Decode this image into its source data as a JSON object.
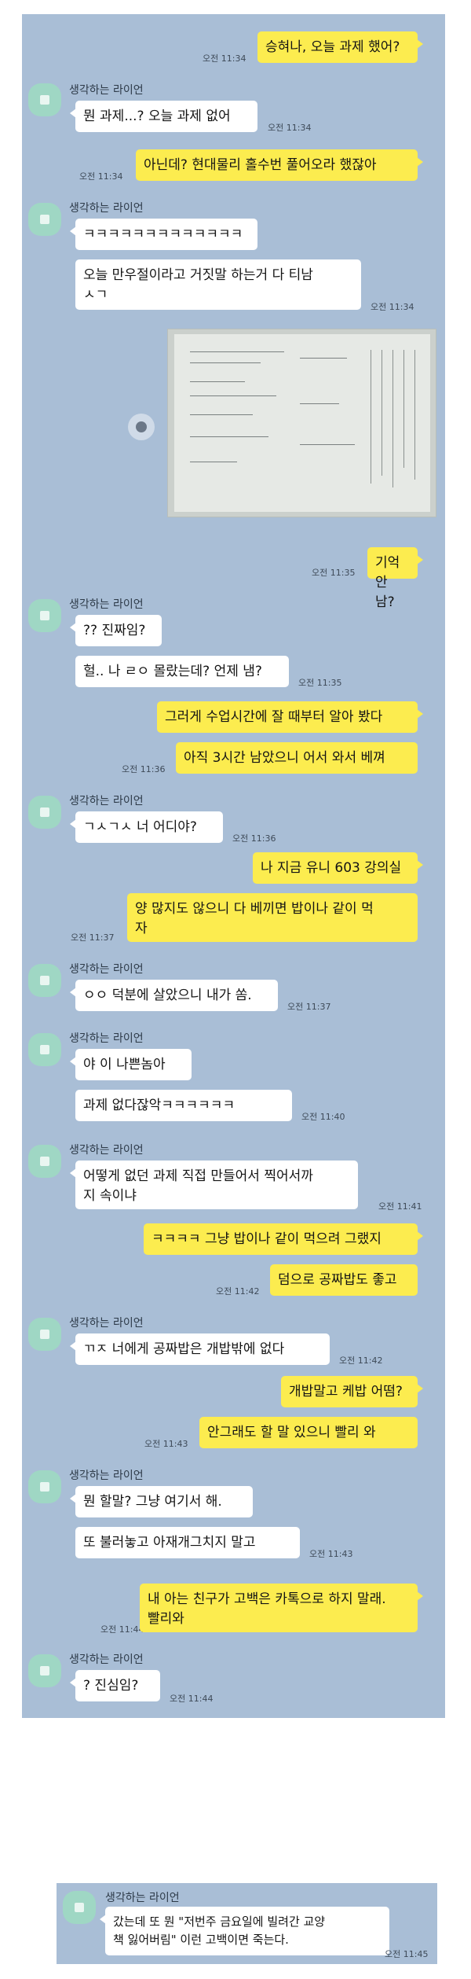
{
  "sender_name": "생각하는 라이언",
  "messages": [
    {
      "id": "m1",
      "side": "out",
      "text": "승혀나, 오늘 과제 했어?",
      "time": "오전 11:34"
    },
    {
      "id": "m2",
      "side": "in",
      "text": "뭔 과제...? 오늘 과제 없어",
      "time": "오전 11:34"
    },
    {
      "id": "m3",
      "side": "out",
      "text": "아닌데? 현대물리 홀수번 풀어오라 했잖아",
      "time": "오전 11:34"
    },
    {
      "id": "m4",
      "side": "in",
      "text": "ㅋㅋㅋㅋㅋㅋㅋㅋㅋㅋㅋㅋㅋ",
      "time": ""
    },
    {
      "id": "m5",
      "side": "in",
      "text": "오늘 만우절이라고 거짓말 하는거 다 티남\nㅅㄱ",
      "time": "오전 11:34"
    },
    {
      "id": "m6",
      "side": "out",
      "text": "기억 안 남?",
      "time": "오전 11:35"
    },
    {
      "id": "m7",
      "side": "in",
      "text": "?? 진짜임?",
      "time": ""
    },
    {
      "id": "m8",
      "side": "in",
      "text": "헐.. 나 ㄹㅇ 몰랐는데? 언제 냄?",
      "time": "오전 11:35"
    },
    {
      "id": "m9",
      "side": "out",
      "text": "그러게 수업시간에 잘 때부터 알아 봤다",
      "time": ""
    },
    {
      "id": "m10",
      "side": "out",
      "text": "아직 3시간 남았으니 어서 와서 베껴",
      "time": "오전 11:36"
    },
    {
      "id": "m11",
      "side": "in",
      "text": "ㄱㅅㄱㅅ 너 어디야?",
      "time": "오전 11:36"
    },
    {
      "id": "m12",
      "side": "out",
      "text": "나 지금 유니 603 강의실",
      "time": ""
    },
    {
      "id": "m13",
      "side": "out",
      "text": "양 많지도 않으니 다 베끼면 밥이나 같이 먹\n자",
      "time": "오전 11:37"
    },
    {
      "id": "m14",
      "side": "in",
      "text": "ㅇㅇ 덕분에 살았으니 내가 쏨.",
      "time": "오전 11:37"
    },
    {
      "id": "m15",
      "side": "in",
      "text": "야 이 나쁜놈아",
      "time": ""
    },
    {
      "id": "m16",
      "side": "in",
      "text": "과제 없다잖악ㅋㅋㅋㅋㅋㅋ",
      "time": "오전 11:40"
    },
    {
      "id": "m17",
      "side": "in",
      "text": "어떻게 없던 과제 직접 만들어서 찍어서까\n지 속이냐",
      "time": "오전 11:41"
    },
    {
      "id": "m18",
      "side": "out",
      "text": "ㅋㅋㅋㅋ 그냥 밥이나 같이 먹으려 그랬지",
      "time": ""
    },
    {
      "id": "m19",
      "side": "out",
      "text": "덤으로 공짜밥도 좋고",
      "time": "오전 11:42"
    },
    {
      "id": "m20",
      "side": "in",
      "text": "ㄲㅈ 너에게 공짜밥은 개밥밖에 없다",
      "time": "오전 11:42"
    },
    {
      "id": "m21",
      "side": "out",
      "text": "개밥말고 케밥 어떰?",
      "time": ""
    },
    {
      "id": "m22",
      "side": "out",
      "text": "안그래도 할 말 있으니 빨리 와",
      "time": "오전 11:43"
    },
    {
      "id": "m23",
      "side": "in",
      "text": "뭔 할말? 그냥 여기서 해.",
      "time": ""
    },
    {
      "id": "m24",
      "side": "in",
      "text": "또 불러놓고 아재개그치지 말고",
      "time": "오전 11:43"
    },
    {
      "id": "m25",
      "side": "out",
      "text": "내 아는 친구가 고백은 카톡으로 하지 말래.\n빨리와",
      "time": "오전 11:44"
    },
    {
      "id": "m26",
      "side": "in",
      "text": "? 진심임?",
      "time": "오전 11:44"
    },
    {
      "id": "m27",
      "side": "in",
      "text": "갔는데 또 뭔 \"저번주 금요일에 빌려간 교양\n책 잃어버림\" 이런 고백이면 죽는다.",
      "time": "오전 11:45"
    }
  ],
  "photo_icon": "share-icon",
  "avatar_icon": "ryan-avatar",
  "colors": {
    "background": "#a9bed6",
    "outgoing": "#fcec4f",
    "incoming": "#ffffff",
    "avatar": "#9fd7c4"
  }
}
